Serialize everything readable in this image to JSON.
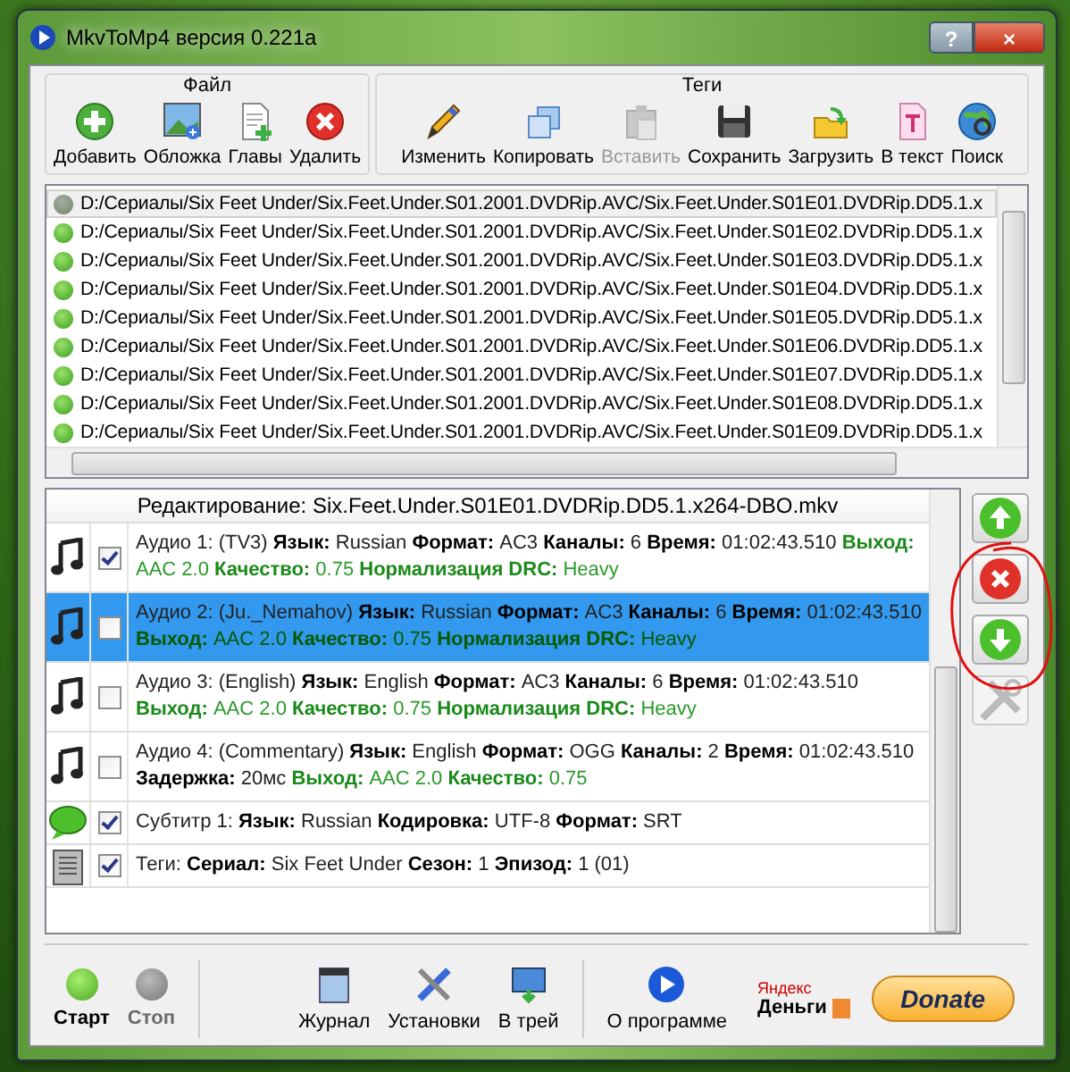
{
  "window": {
    "title": "MkvToMp4 версия 0.221a",
    "buttons": [
      "?",
      "×"
    ]
  },
  "toolbar": {
    "groups": [
      {
        "title": "Файл",
        "buttons": [
          {
            "label": "Добавить",
            "disabled": false
          },
          {
            "label": "Обложка",
            "disabled": false
          },
          {
            "label": "Главы",
            "disabled": false
          },
          {
            "label": "Удалить",
            "disabled": false
          }
        ]
      },
      {
        "title": "Теги",
        "buttons": [
          {
            "label": "Изменить",
            "disabled": false
          },
          {
            "label": "Копировать",
            "disabled": false
          },
          {
            "label": "Вставить",
            "disabled": true
          },
          {
            "label": "Сохранить",
            "disabled": false
          },
          {
            "label": "Загрузить",
            "disabled": false
          },
          {
            "label": "В текст",
            "disabled": false
          },
          {
            "label": "Поиск",
            "disabled": false
          }
        ]
      }
    ]
  },
  "files": [
    {
      "path": "D:/Сериалы/Six Feet Under/Six.Feet.Under.S01.2001.DVDRip.AVC/Six.Feet.Under.S01E01.DVDRip.DD5.1.x",
      "selected": true
    },
    {
      "path": "D:/Сериалы/Six Feet Under/Six.Feet.Under.S01.2001.DVDRip.AVC/Six.Feet.Under.S01E02.DVDRip.DD5.1.x",
      "selected": false
    },
    {
      "path": "D:/Сериалы/Six Feet Under/Six.Feet.Under.S01.2001.DVDRip.AVC/Six.Feet.Under.S01E03.DVDRip.DD5.1.x",
      "selected": false
    },
    {
      "path": "D:/Сериалы/Six Feet Under/Six.Feet.Under.S01.2001.DVDRip.AVC/Six.Feet.Under.S01E04.DVDRip.DD5.1.x",
      "selected": false
    },
    {
      "path": "D:/Сериалы/Six Feet Under/Six.Feet.Under.S01.2001.DVDRip.AVC/Six.Feet.Under.S01E05.DVDRip.DD5.1.x",
      "selected": false
    },
    {
      "path": "D:/Сериалы/Six Feet Under/Six.Feet.Under.S01.2001.DVDRip.AVC/Six.Feet.Under.S01E06.DVDRip.DD5.1.x",
      "selected": false
    },
    {
      "path": "D:/Сериалы/Six Feet Under/Six.Feet.Under.S01.2001.DVDRip.AVC/Six.Feet.Under.S01E07.DVDRip.DD5.1.x",
      "selected": false
    },
    {
      "path": "D:/Сериалы/Six Feet Under/Six.Feet.Under.S01.2001.DVDRip.AVC/Six.Feet.Under.S01E08.DVDRip.DD5.1.x",
      "selected": false
    },
    {
      "path": "D:/Сериалы/Six Feet Under/Six.Feet.Under.S01.2001.DVDRip.AVC/Six.Feet.Under.S01E09.DVDRip.DD5.1.x",
      "selected": false
    }
  ],
  "editor": {
    "header": "Редактирование: Six.Feet.Under.S01E01.DVDRip.DD5.1.x264-DBO.mkv",
    "tracks": [
      {
        "kind": "audio",
        "checked": true,
        "selected": false,
        "parts": [
          {
            "kind": "text",
            "text": "Аудио 1: (TV3)"
          },
          {
            "kind": "key",
            "text": "Язык:"
          },
          {
            "kind": "text",
            "text": "Russian"
          },
          {
            "kind": "key",
            "text": "Формат:"
          },
          {
            "kind": "text",
            "text": "AC3"
          },
          {
            "kind": "key",
            "text": "Каналы:"
          },
          {
            "kind": "text",
            "text": "6"
          },
          {
            "kind": "key",
            "text": "Время:"
          },
          {
            "kind": "text",
            "text": "01:02:43.510"
          },
          {
            "kind": "out_key",
            "text": "Выход:"
          },
          {
            "kind": "out_value",
            "text": "AAC 2.0"
          },
          {
            "kind": "out_key",
            "text": "Качество:"
          },
          {
            "kind": "out_value",
            "text": "0.75"
          },
          {
            "kind": "out_key",
            "text": "Нормализация DRC:"
          },
          {
            "kind": "out_value",
            "text": "Heavy"
          }
        ]
      },
      {
        "kind": "audio",
        "checked": false,
        "selected": true,
        "parts": [
          {
            "kind": "text",
            "text": "Аудио 2: (Ju._Nemahov)"
          },
          {
            "kind": "key",
            "text": "Язык:"
          },
          {
            "kind": "text",
            "text": "Russian"
          },
          {
            "kind": "key",
            "text": "Формат:"
          },
          {
            "kind": "text",
            "text": "AC3"
          },
          {
            "kind": "key",
            "text": "Каналы:"
          },
          {
            "kind": "text",
            "text": "6"
          },
          {
            "kind": "key",
            "text": "Время:"
          },
          {
            "kind": "text",
            "text": "01:02:43.510"
          },
          {
            "kind": "out_key",
            "text": "Выход:"
          },
          {
            "kind": "out_value",
            "text": "AAC 2.0"
          },
          {
            "kind": "out_key",
            "text": "Качество:"
          },
          {
            "kind": "out_value",
            "text": "0.75"
          },
          {
            "kind": "out_key",
            "text": "Нормализация DRC:"
          },
          {
            "kind": "out_value",
            "text": "Heavy"
          }
        ]
      },
      {
        "kind": "audio",
        "checked": false,
        "selected": false,
        "parts": [
          {
            "kind": "text",
            "text": "Аудио 3: (English)"
          },
          {
            "kind": "key",
            "text": "Язык:"
          },
          {
            "kind": "text",
            "text": "English"
          },
          {
            "kind": "key",
            "text": "Формат:"
          },
          {
            "kind": "text",
            "text": "AC3"
          },
          {
            "kind": "key",
            "text": "Каналы:"
          },
          {
            "kind": "text",
            "text": "6"
          },
          {
            "kind": "key",
            "text": "Время:"
          },
          {
            "kind": "text",
            "text": "01:02:43.510"
          },
          {
            "kind": "out_key",
            "text": "Выход:"
          },
          {
            "kind": "out_value",
            "text": "AAC 2.0"
          },
          {
            "kind": "out_key",
            "text": "Качество:"
          },
          {
            "kind": "out_value",
            "text": "0.75"
          },
          {
            "kind": "out_key",
            "text": "Нормализация DRC:"
          },
          {
            "kind": "out_value",
            "text": "Heavy"
          }
        ]
      },
      {
        "kind": "audio",
        "checked": false,
        "selected": false,
        "parts": [
          {
            "kind": "text",
            "text": "Аудио 4: (Commentary)"
          },
          {
            "kind": "key",
            "text": "Язык:"
          },
          {
            "kind": "text",
            "text": "English"
          },
          {
            "kind": "key",
            "text": "Формат:"
          },
          {
            "kind": "text",
            "text": "OGG"
          },
          {
            "kind": "key",
            "text": "Каналы:"
          },
          {
            "kind": "text",
            "text": "2"
          },
          {
            "kind": "key",
            "text": "Время:"
          },
          {
            "kind": "text",
            "text": "01:02:43.510"
          },
          {
            "kind": "key",
            "text": "Задержка:"
          },
          {
            "kind": "text",
            "text": "20мс"
          },
          {
            "kind": "out_key",
            "text": "Выход:"
          },
          {
            "kind": "out_value",
            "text": "AAC 2.0"
          },
          {
            "kind": "out_key",
            "text": "Качество:"
          },
          {
            "kind": "out_value",
            "text": "0.75"
          }
        ]
      },
      {
        "kind": "subtitle",
        "checked": true,
        "selected": false,
        "parts": [
          {
            "kind": "text",
            "text": "Субтитр 1:"
          },
          {
            "kind": "key",
            "text": "Язык:"
          },
          {
            "kind": "text",
            "text": "Russian"
          },
          {
            "kind": "key",
            "text": "Кодировка:"
          },
          {
            "kind": "text",
            "text": "UTF-8"
          },
          {
            "kind": "key",
            "text": "Формат:"
          },
          {
            "kind": "text",
            "text": "SRT"
          }
        ]
      },
      {
        "kind": "tags",
        "checked": true,
        "selected": false,
        "parts": [
          {
            "kind": "text",
            "text": "Теги:"
          },
          {
            "kind": "key",
            "text": "Сериал:"
          },
          {
            "kind": "text",
            "text": "Six Feet Under"
          },
          {
            "kind": "key",
            "text": "Сезон:"
          },
          {
            "kind": "text",
            "text": "1"
          },
          {
            "kind": "key",
            "text": "Эпизод:"
          },
          {
            "kind": "text",
            "text": "1 (01)"
          }
        ]
      }
    ],
    "side_buttons": [
      {
        "disabled": false
      },
      {
        "disabled": false
      },
      {
        "disabled": false
      },
      {
        "disabled": true
      }
    ]
  },
  "bottom": {
    "run": [
      {
        "label": "Старт",
        "disabled": false
      },
      {
        "label": "Стоп",
        "disabled": true
      }
    ],
    "tools": [
      {
        "label": "Журнал"
      },
      {
        "label": "Установки"
      },
      {
        "label": "В трей"
      }
    ],
    "about": {
      "label": "О программе"
    },
    "yandex": {
      "top": "Яндекс",
      "bottom": "Деньги"
    },
    "donate": {
      "label": "Donate"
    }
  }
}
